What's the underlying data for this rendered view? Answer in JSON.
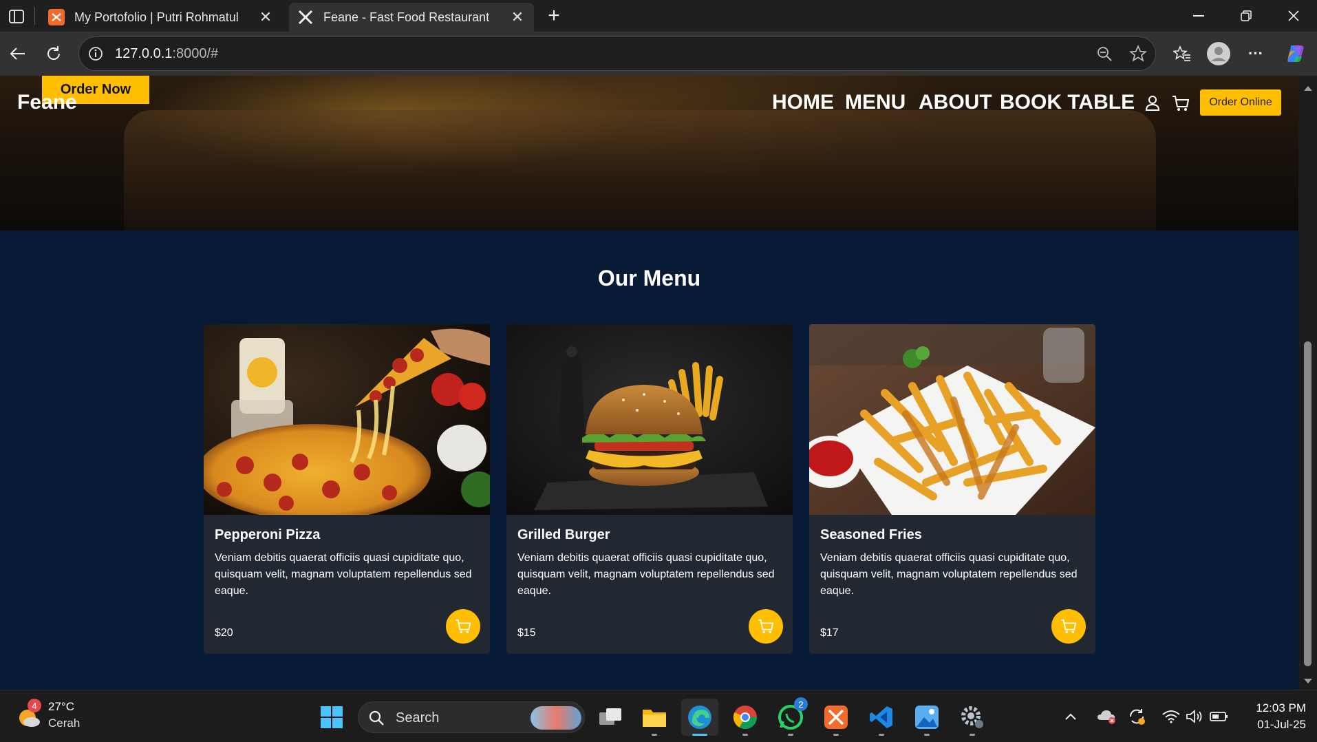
{
  "browser": {
    "tabs": [
      {
        "title": "My Portofolio | Putri Rohmatul",
        "active": false
      },
      {
        "title": "Feane - Fast Food Restaurant",
        "active": true
      }
    ],
    "url": {
      "host": "127.0.0.1",
      "rest": ":8000/#"
    }
  },
  "header": {
    "order_now": "Order Now",
    "logo": "Feane",
    "nav": [
      "HOME",
      "MENU",
      "ABOUT",
      "BOOK TABLE"
    ],
    "order_online": "Order Online"
  },
  "menu": {
    "title": "Our Menu",
    "items": [
      {
        "name": "Pepperoni Pizza",
        "desc": "Veniam debitis quaerat officiis quasi cupiditate quo, quisquam velit, magnam voluptatem repellendus sed eaque.",
        "price": "$20"
      },
      {
        "name": "Grilled Burger",
        "desc": "Veniam debitis quaerat officiis quasi cupiditate quo, quisquam velit, magnam voluptatem repellendus sed eaque.",
        "price": "$15"
      },
      {
        "name": "Seasoned Fries",
        "desc": "Veniam debitis quaerat officiis quasi cupiditate quo, quisquam velit, magnam voluptatem repellendus sed eaque.",
        "price": "$17"
      }
    ]
  },
  "taskbar": {
    "weather": {
      "temp": "27°C",
      "condition": "Cerah",
      "badge": "4"
    },
    "search_placeholder": "Search",
    "whatsapp_badge": "2",
    "time": "12:03 PM",
    "date": "01-Jul-25"
  },
  "colors": {
    "accent": "#ffbe00",
    "page_bg": "#071a36",
    "card_bg": "#222831"
  }
}
